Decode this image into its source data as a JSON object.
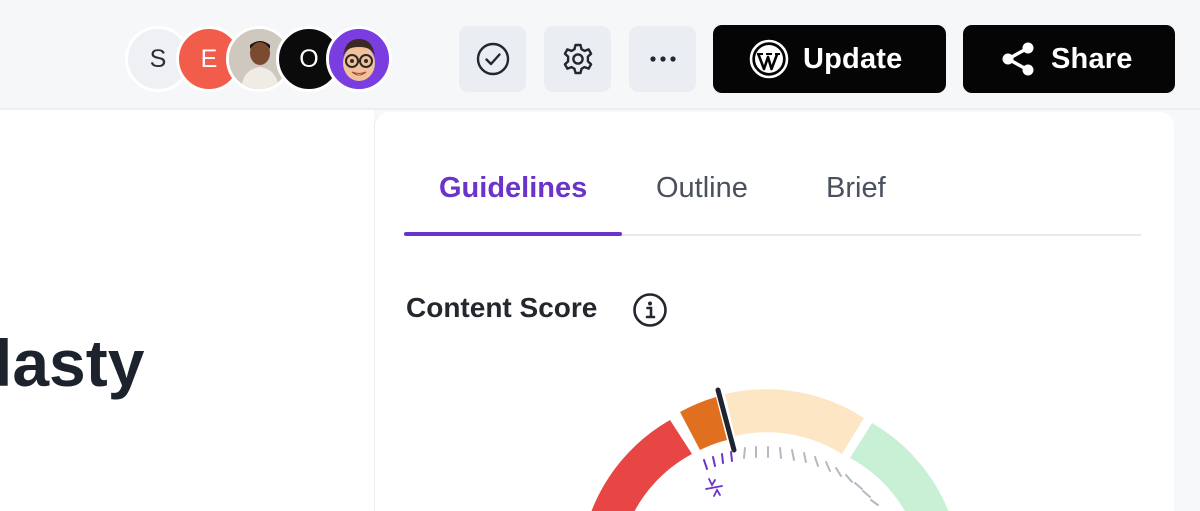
{
  "header": {
    "collaborators": [
      {
        "initial": "S",
        "color": "#eef0f4"
      },
      {
        "initial": "E",
        "color": "#f25c4b"
      },
      {
        "initial": "",
        "color": "#c9c2b8",
        "icon": "photo-avatar"
      },
      {
        "initial": "O",
        "color": "#0b0b0b"
      },
      {
        "initial": "",
        "color": "#7a3ee0",
        "icon": "memoji-avatar"
      }
    ],
    "icon_buttons": [
      "check-circle-icon",
      "gear-icon",
      "more-icon"
    ],
    "update_label": "Update",
    "share_label": "Share"
  },
  "editor": {
    "title_fragment": "lasty"
  },
  "panel": {
    "tabs": [
      {
        "label": "Guidelines",
        "active": true
      },
      {
        "label": "Outline",
        "active": false
      },
      {
        "label": "Brief",
        "active": false
      }
    ],
    "content_score_label": "Content Score"
  },
  "colors": {
    "accent": "#6b33c9",
    "dark_button": "#050505",
    "gauge_red": "#e84545",
    "gauge_orange": "#e07020",
    "gauge_peach": "#fde6c4",
    "gauge_green": "#c8f0d4"
  }
}
